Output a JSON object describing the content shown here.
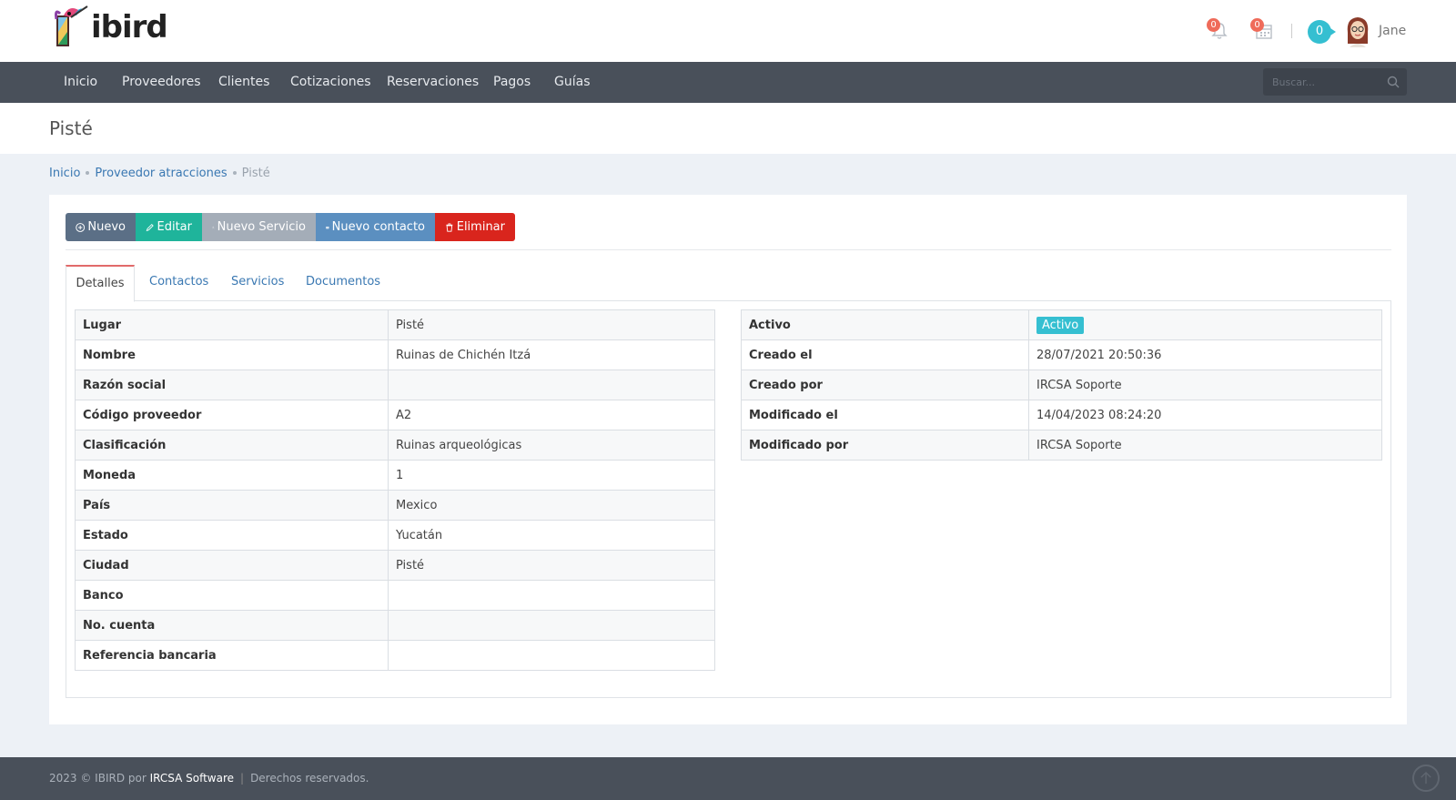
{
  "header": {
    "logo_text_i": "i",
    "logo_text_rest": "bird",
    "notifications_count": "0",
    "calendar_count": "0",
    "chat_count": "0",
    "user_name": "Jane"
  },
  "nav": {
    "items": [
      {
        "label": "Inicio"
      },
      {
        "label": "Proveedores"
      },
      {
        "label": "Clientes"
      },
      {
        "label": "Cotizaciones"
      },
      {
        "label": "Reservaciones"
      },
      {
        "label": "Pagos"
      },
      {
        "label": "Guías"
      }
    ],
    "search_placeholder": "Buscar..."
  },
  "page": {
    "title": "Pisté"
  },
  "breadcrumb": {
    "items": [
      {
        "label": "Inicio"
      },
      {
        "label": "Proveedor atracciones"
      }
    ],
    "current": "Pisté"
  },
  "toolbar": {
    "nuevo": "Nuevo",
    "editar": "Editar",
    "nuevo_servicio": "Nuevo Servicio",
    "nuevo_contacto": "Nuevo contacto",
    "eliminar": "Eliminar"
  },
  "tabs": [
    {
      "label": "Detalles",
      "active": true
    },
    {
      "label": "Contactos"
    },
    {
      "label": "Servicios"
    },
    {
      "label": "Documentos"
    }
  ],
  "details_left": [
    {
      "key": "Lugar",
      "value": "Pisté"
    },
    {
      "key": "Nombre",
      "value": "Ruinas de Chichén Itzá"
    },
    {
      "key": "Razón social",
      "value": ""
    },
    {
      "key": "Código proveedor",
      "value": "A2"
    },
    {
      "key": "Clasificación",
      "value": "Ruinas arqueológicas"
    },
    {
      "key": "Moneda",
      "value": "1"
    },
    {
      "key": "País",
      "value": "Mexico"
    },
    {
      "key": "Estado",
      "value": "Yucatán"
    },
    {
      "key": "Ciudad",
      "value": "Pisté"
    },
    {
      "key": "Banco",
      "value": ""
    },
    {
      "key": "No. cuenta",
      "value": ""
    },
    {
      "key": "Referencia bancaria",
      "value": ""
    }
  ],
  "details_right": [
    {
      "key": "Activo",
      "value": "Activo"
    },
    {
      "key": "Creado el",
      "value": "28/07/2021 20:50:36"
    },
    {
      "key": "Creado por",
      "value": "IRCSA Soporte"
    },
    {
      "key": "Modificado el",
      "value": "14/04/2023 08:24:20"
    },
    {
      "key": "Modificado por",
      "value": "IRCSA Soporte"
    }
  ],
  "footer": {
    "prefix": "2023 © IBIRD por",
    "company": "IRCSA Software",
    "rights": "Derechos reservados."
  },
  "colors": {
    "nav_bg": "#49505a",
    "accent_teal": "#35bfd1",
    "btn_nuevo": "#5b6f86",
    "btn_editar": "#1fb49b",
    "btn_servicio": "#a4adb8",
    "btn_contacto": "#5b8fc0",
    "btn_eliminar": "#d9251d",
    "link": "#3a78b2"
  }
}
